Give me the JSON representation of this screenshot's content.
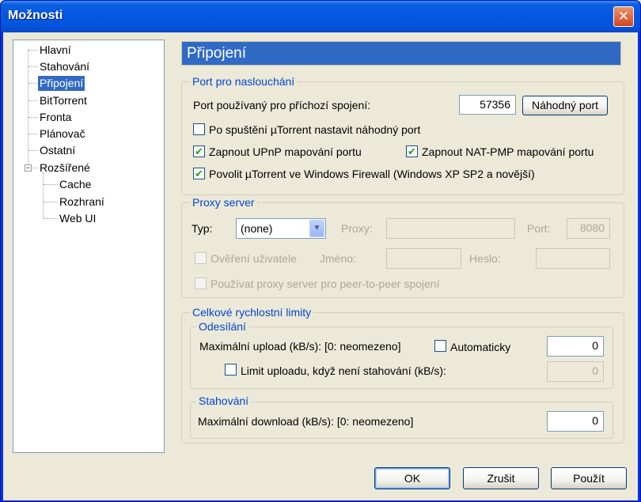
{
  "window": {
    "title": "Možnosti",
    "close_glyph": "✕"
  },
  "tree": {
    "items": [
      {
        "label": "Hlavní"
      },
      {
        "label": "Stahování"
      },
      {
        "label": "Připojení"
      },
      {
        "label": "BitTorrent"
      },
      {
        "label": "Fronta"
      },
      {
        "label": "Plánovač"
      },
      {
        "label": "Ostatní"
      },
      {
        "label": "Rozšířené"
      }
    ],
    "subitems": [
      {
        "label": "Cache"
      },
      {
        "label": "Rozhraní"
      },
      {
        "label": "Web UI"
      }
    ],
    "expander_glyph": "−",
    "selected": "Připojení"
  },
  "page": {
    "title": "Připojení"
  },
  "listen": {
    "group": "Port pro naslouchání",
    "port_label": "Port používaný pro příchozí spojení:",
    "port_value": "57356",
    "random_button": "Náhodný port",
    "cb_random_start": {
      "label": "Po spuštění µTorrent nastavit náhodný port",
      "checked": false
    },
    "cb_upnp": {
      "label": "Zapnout UPnP mapování portu",
      "checked": true
    },
    "cb_natpmp": {
      "label": "Zapnout NAT-PMP mapování portu",
      "checked": true
    },
    "cb_firewall": {
      "label": "Povolit µTorrent ve Windows Firewall (Windows XP SP2 a novější)",
      "checked": true
    },
    "check_glyph": "✔"
  },
  "proxy": {
    "group": "Proxy server",
    "type_label": "Typ:",
    "type_value": "(none)",
    "arrow_glyph": "▼",
    "proxy_label": "Proxy:",
    "proxy_value": "",
    "port_label": "Port:",
    "port_value": "8080",
    "cb_auth": {
      "label": "Ověření uživatele",
      "checked": false
    },
    "name_label": "Jméno:",
    "password_label": "Heslo:",
    "cb_p2p": {
      "label": "Používat proxy server pro peer-to-peer spojení",
      "checked": false
    }
  },
  "limits": {
    "group": "Celkové rychlostní limity",
    "upload_group": "Odesílání",
    "upload_label": "Maximální upload (kB/s): [0: neomezeno]",
    "cb_auto": {
      "label": "Automaticky",
      "checked": false
    },
    "upload_value": "0",
    "cb_limit_no_dl": {
      "label": "Limit uploadu, když není stahování (kB/s):",
      "checked": false
    },
    "limit_no_dl_value": "0",
    "download_group": "Stahování",
    "download_label": "Maximální download (kB/s): [0: neomezeno]",
    "download_value": "0"
  },
  "buttons": {
    "ok": "OK",
    "cancel": "Zrušit",
    "apply": "Použít"
  }
}
